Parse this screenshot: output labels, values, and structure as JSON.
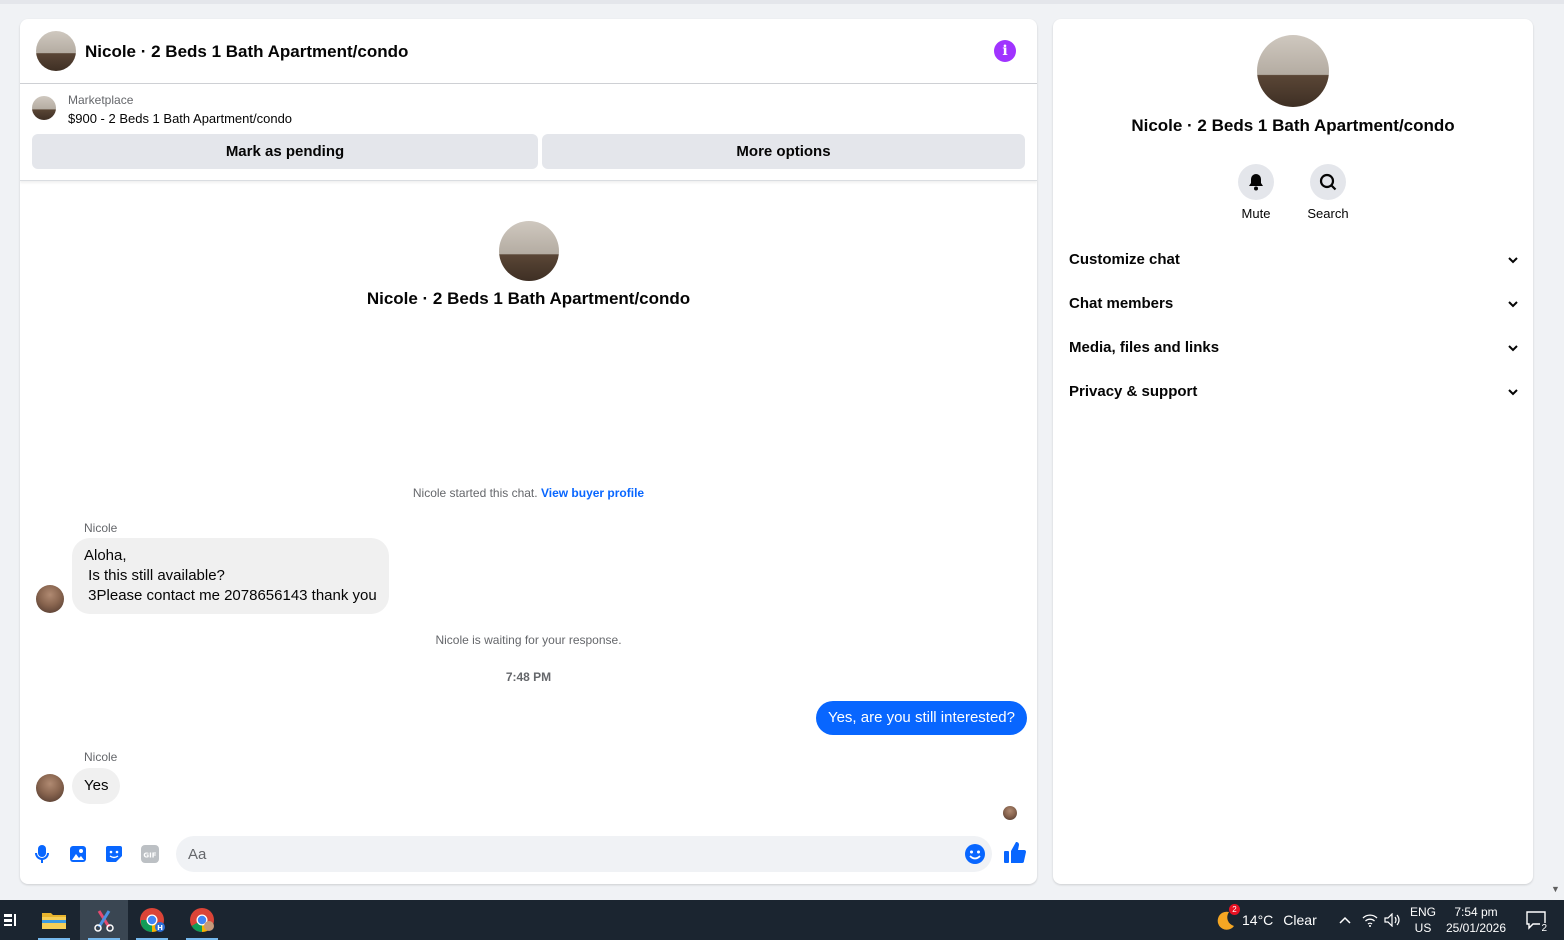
{
  "conversation": {
    "title": "Nicole · 2 Beds 1 Bath Apartment/condo",
    "info_icon": "i"
  },
  "marketplace": {
    "label": "Marketplace",
    "item": "$900 - 2 Beds 1 Bath Apartment/condo",
    "mark_pending_label": "Mark as pending",
    "more_options_label": "More options"
  },
  "intro": {
    "name": "Nicole · 2 Beds 1 Bath Apartment/condo",
    "started_text": "Nicole started this chat.",
    "buyer_profile_link": "View buyer profile"
  },
  "messages": [
    {
      "sender": "Nicole",
      "text": "Aloha,\n Is this still available?\n 3Please contact me 2078656143 thank you"
    },
    {
      "sender": "Me",
      "text": "Yes, are you still interested?"
    },
    {
      "sender": "Nicole",
      "text": "Yes"
    }
  ],
  "waiting_text": "Nicole is waiting for your response.",
  "timestamp": "7:48 PM",
  "composer": {
    "placeholder": "Aa",
    "icons": [
      "microphone-icon",
      "photo-icon",
      "sticker-icon",
      "gif-icon",
      "emoji-icon",
      "like-icon"
    ],
    "gif_label": "GIF"
  },
  "sidebar": {
    "name": "Nicole · 2 Beds 1 Bath Apartment/condo",
    "actions": [
      {
        "label": "Mute",
        "icon": "bell-icon"
      },
      {
        "label": "Search",
        "icon": "search-icon"
      }
    ],
    "sections": [
      {
        "label": "Customize chat"
      },
      {
        "label": "Chat members"
      },
      {
        "label": "Media, files and links"
      },
      {
        "label": "Privacy & support"
      }
    ]
  },
  "taskbar": {
    "weather_temp": "14°C",
    "weather_desc": "Clear",
    "weather_badge": "2",
    "language_top": "ENG",
    "language_bottom": "US",
    "time": "7:54 pm",
    "date": "25/01/2026",
    "notification_count": "2"
  },
  "colors": {
    "accent": "#0866ff",
    "info": "#a033ff",
    "taskbar": "#1b2530"
  }
}
